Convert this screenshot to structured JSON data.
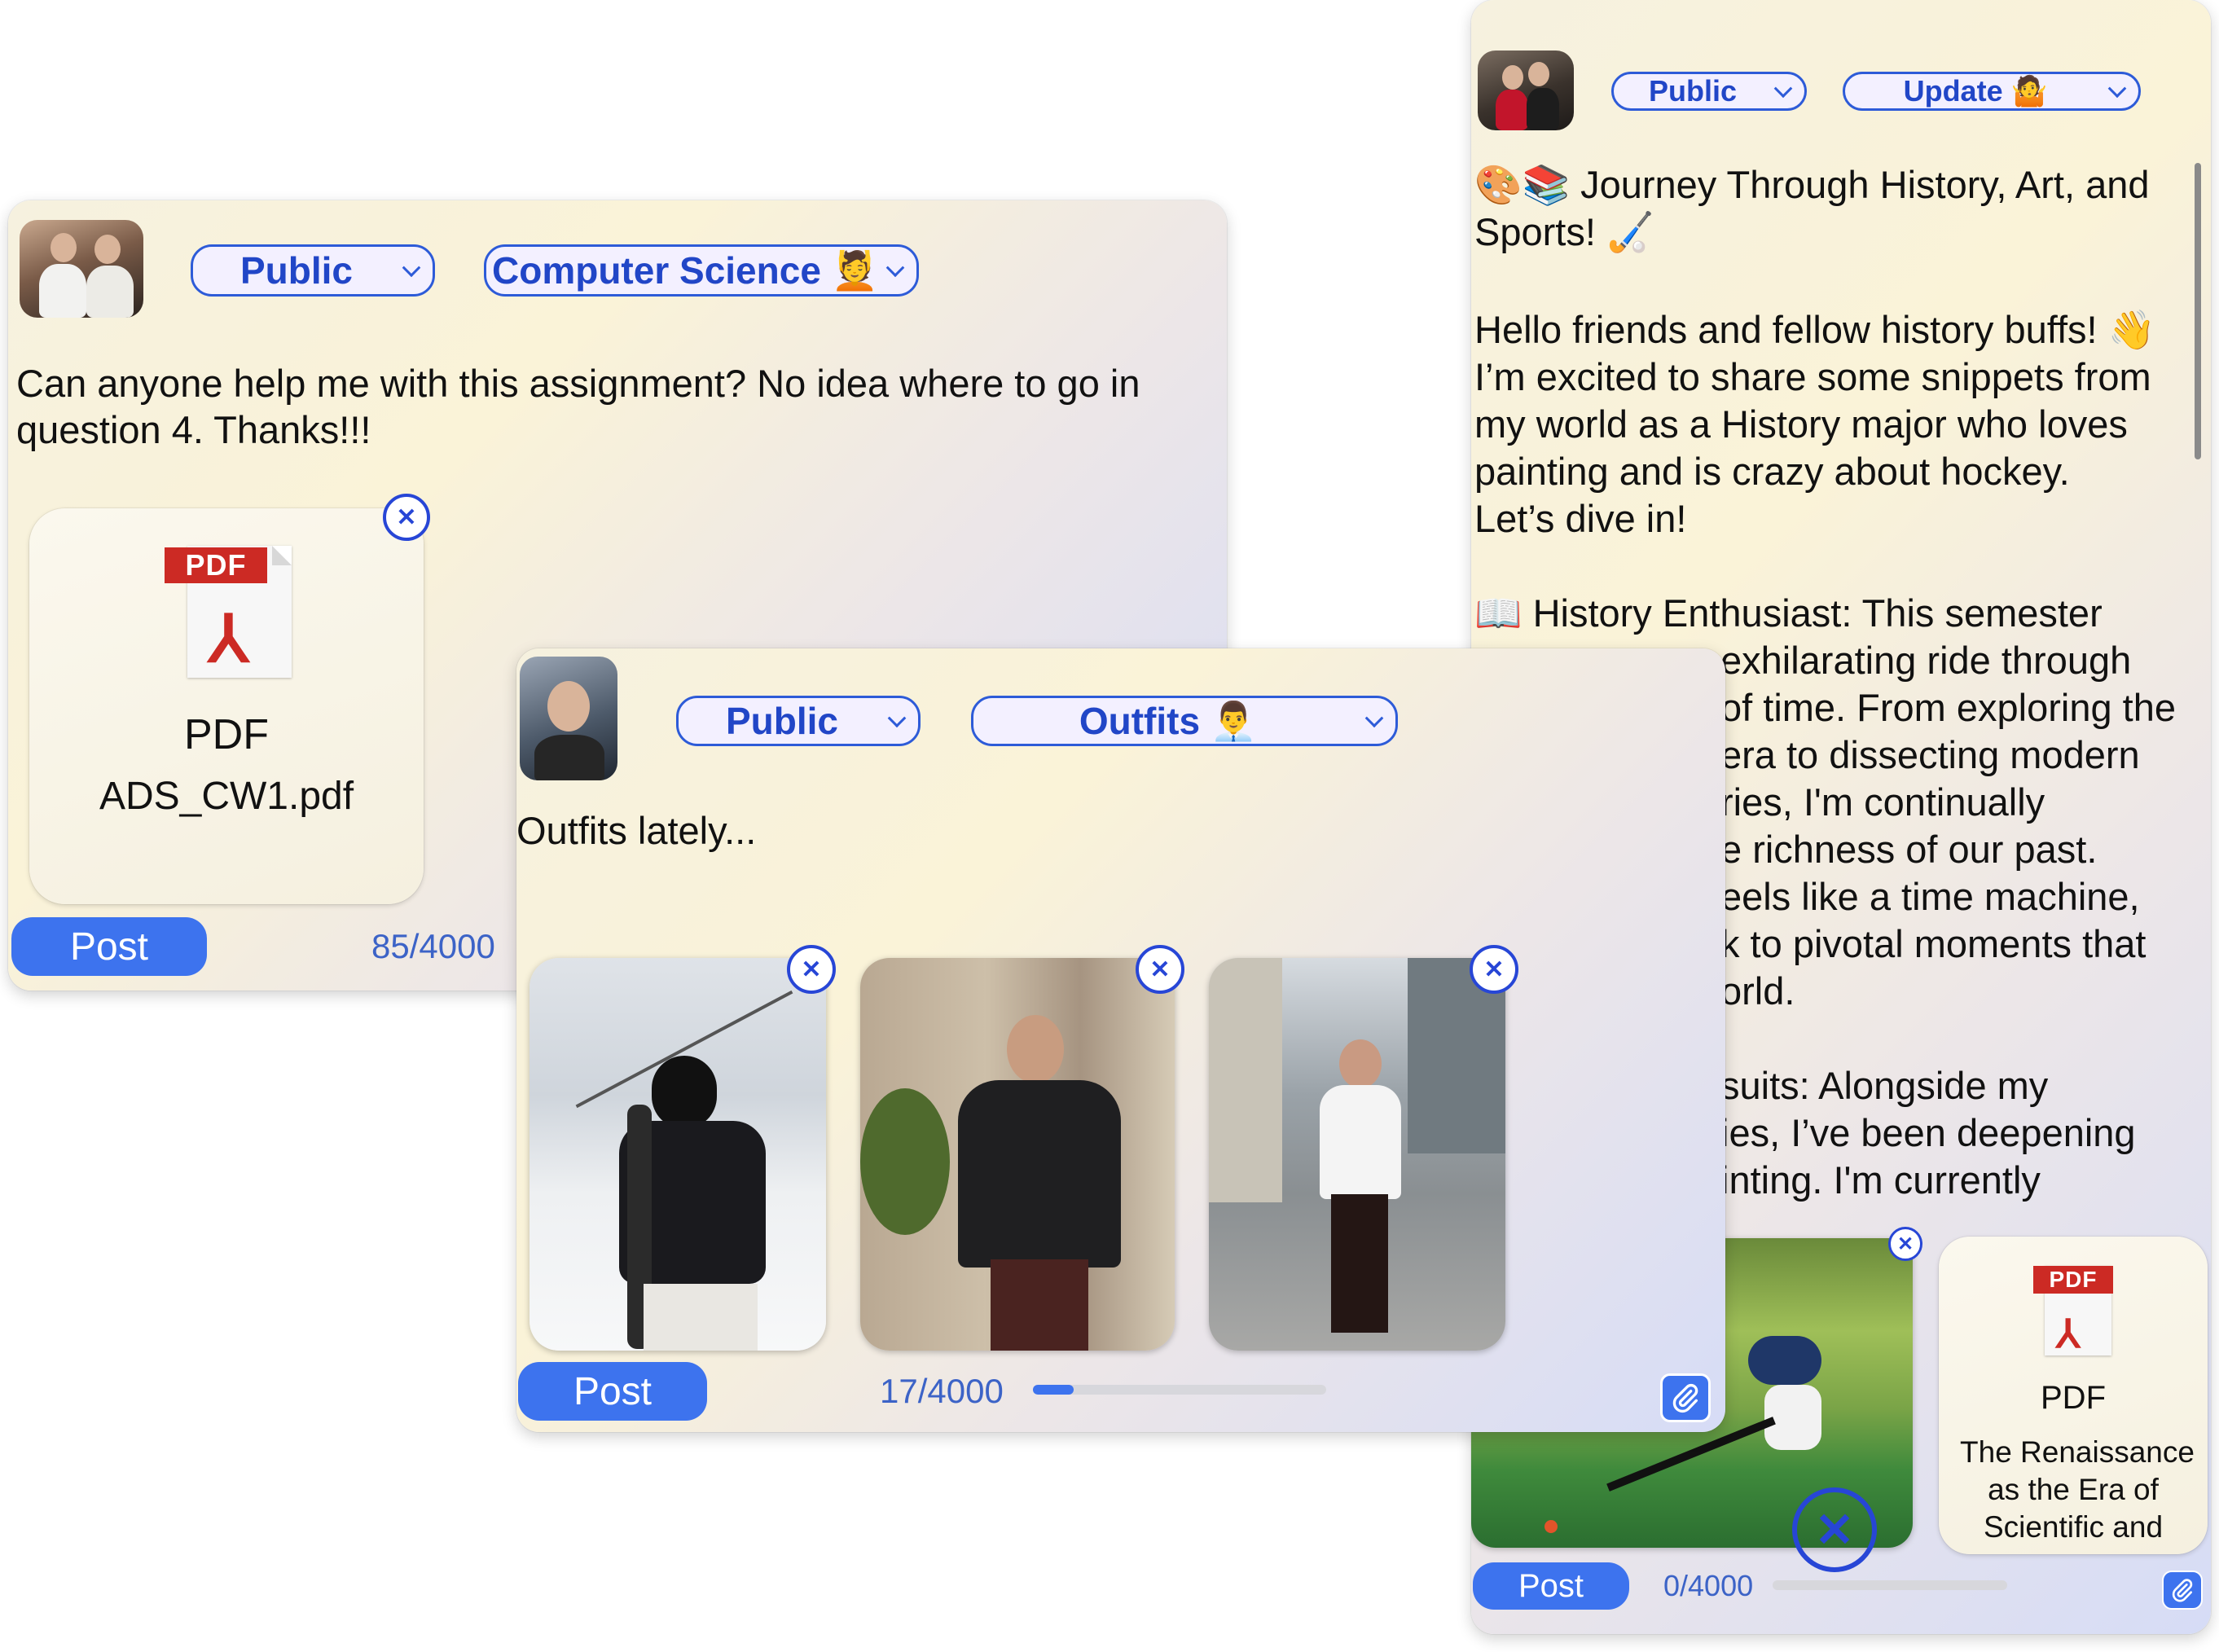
{
  "card_cs": {
    "visibility": "Public",
    "category": "Computer Science 💆",
    "text": "Can anyone help me with this assignment? No idea where to go in question 4. Thanks!!!",
    "attachment": {
      "badge": "PDF",
      "type_label": "PDF",
      "filename": "ADS_CW1.pdf"
    },
    "post_label": "Post",
    "counter": "85/4000"
  },
  "card_outfits": {
    "visibility": "Public",
    "category": "Outfits 👨‍💼",
    "text": "Outfits lately...",
    "post_label": "Post",
    "counter": "17/4000",
    "progress_fraction": 0.14
  },
  "card_history": {
    "visibility": "Public",
    "category": "Update 🤷",
    "title_line1": "🎨📚 Journey Through History, Art, and",
    "title_line2": "Sports! 🏑",
    "para1": [
      "Hello friends and fellow history buffs! 👋",
      "I’m excited to share some snippets from",
      "my world as a History major who loves",
      "painting and is crazy about hockey.",
      "Let’s dive in!"
    ],
    "para2_first": "📖 History Enthusiast: This semester",
    "para2_rest": [
      "exhilarating ride through",
      "of time. From exploring the",
      "era to dissecting modern",
      "ries, I'm continually",
      "e richness of our past.",
      "eels like a time machine,",
      "k to pivotal moments that",
      "orld."
    ],
    "para3": [
      "suits: Alongside my",
      "ies, I’ve been deepening",
      "inting. I'm currently"
    ],
    "attachment": {
      "badge": "PDF",
      "type_label": "PDF",
      "title_lines": [
        "The Renaissance",
        "as the Era of",
        "Scientific and"
      ]
    },
    "post_label": "Post",
    "counter": "0/4000",
    "progress_fraction": 0.0
  },
  "icons": {
    "remove": "close-circle-icon",
    "attach": "paperclip-icon",
    "dropdown": "chevron-down-icon"
  },
  "colors": {
    "accent": "#3d73ee",
    "select_border": "#2d5bd8",
    "counter": "#3c63c7",
    "pdf_red": "#cc2a24"
  }
}
